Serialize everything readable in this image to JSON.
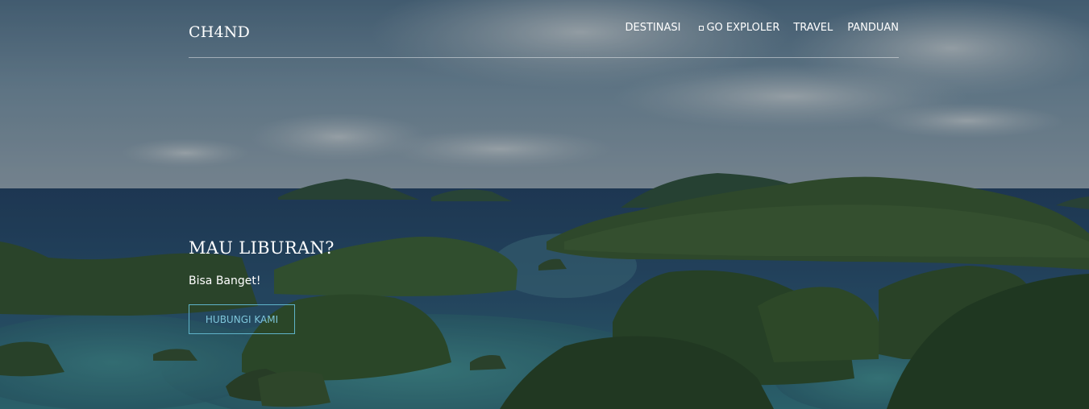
{
  "brand": "CH4ND",
  "nav": {
    "items": [
      {
        "label": "DESTINASI"
      },
      {
        "label": "GO EXPLOLER"
      },
      {
        "label": "TRAVEL"
      },
      {
        "label": "PANDUAN"
      }
    ]
  },
  "hero": {
    "title": "MAU LIBURAN?",
    "subtitle": "Bisa Banget!",
    "button_label": "HUBUNGI KAMI"
  },
  "colors": {
    "button_border": "#5fb3c9",
    "button_text": "#7ec6da",
    "text": "#ffffff"
  },
  "icons": {
    "go_exploler": "broken-image-icon"
  }
}
